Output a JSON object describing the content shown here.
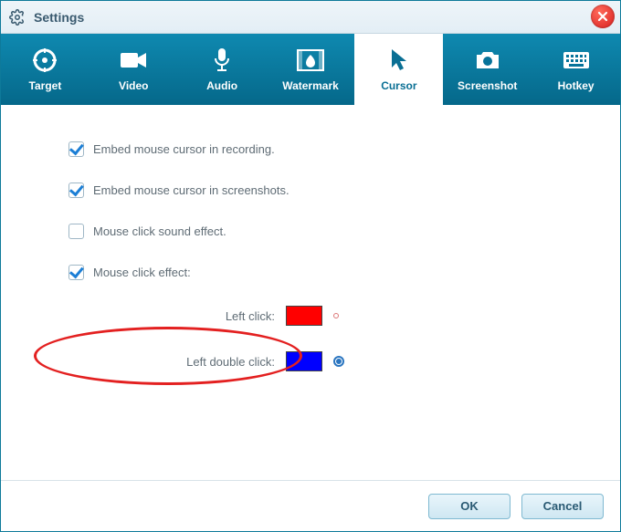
{
  "window": {
    "title": "Settings"
  },
  "tabs": [
    {
      "label": "Target"
    },
    {
      "label": "Video"
    },
    {
      "label": "Audio"
    },
    {
      "label": "Watermark"
    },
    {
      "label": "Cursor",
      "active": true
    },
    {
      "label": "Screenshot"
    },
    {
      "label": "Hotkey"
    }
  ],
  "options": {
    "embed_recording": {
      "label": "Embed mouse cursor in recording.",
      "checked": true
    },
    "embed_screenshots": {
      "label": "Embed mouse cursor in screenshots.",
      "checked": true
    },
    "click_sound": {
      "label": "Mouse click sound effect.",
      "checked": false
    },
    "click_effect": {
      "label": "Mouse click effect:",
      "checked": true
    },
    "left_click": {
      "label": "Left click:",
      "color": "#ff0000"
    },
    "left_double_click": {
      "label": "Left double click:",
      "color": "#0000ff"
    }
  },
  "buttons": {
    "ok": "OK",
    "cancel": "Cancel"
  }
}
